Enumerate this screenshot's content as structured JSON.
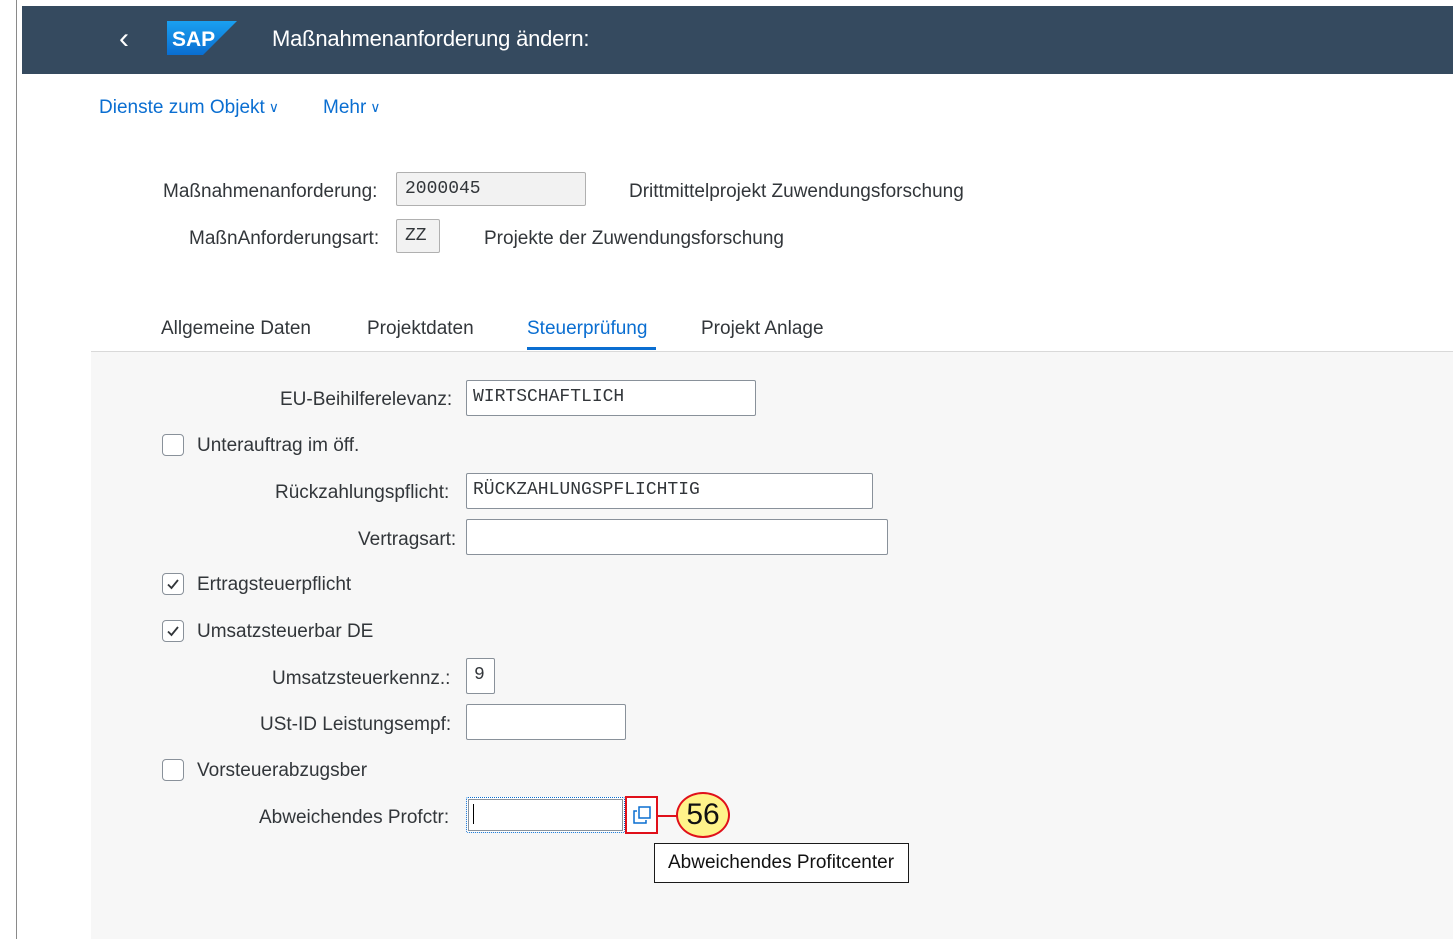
{
  "header": {
    "title": "Maßnahmenanforderung ändern:",
    "logo_text": "SAP",
    "colors": {
      "shell": "#354a5f",
      "accent": "#0a6ed1"
    }
  },
  "menu": {
    "services": "Dienste zum Objekt",
    "more": "Mehr"
  },
  "object": {
    "request_label": "Maßnahmenanforderung:",
    "request_value": "2000045",
    "request_desc": "Drittmittelprojekt Zuwendungsforschung",
    "type_label": "MaßnAnforderungsart:",
    "type_value": "ZZ",
    "type_desc": "Projekte der Zuwendungsforschung"
  },
  "tabs": [
    {
      "label": "Allgemeine Daten",
      "active": false
    },
    {
      "label": "Projektdaten",
      "active": false
    },
    {
      "label": "Steuerprüfung",
      "active": true
    },
    {
      "label": "Projekt Anlage",
      "active": false
    }
  ],
  "form": {
    "eu_label": "EU-Beihilferelevanz:",
    "eu_value": "WIRTSCHAFTLICH",
    "subcontract_label": "Unterauftrag im öff.",
    "subcontract_checked": false,
    "repay_label": "Rückzahlungspflicht:",
    "repay_value": "RÜCKZAHLUNGSPFLICHTIG",
    "contract_label": "Vertragsart:",
    "contract_value": "",
    "income_tax_label": "Ertragsteuerpflicht",
    "income_tax_checked": true,
    "vat_label": "Umsatzsteuerbar DE",
    "vat_checked": true,
    "vat_code_label": "Umsatzsteuerkennz.:",
    "vat_code_value": "9",
    "vat_id_label": "USt-ID Leistungsempf:",
    "vat_id_value": "",
    "input_tax_label": "Vorsteuerabzugsber",
    "input_tax_checked": false,
    "profit_center_label": "Abweichendes Profctr:",
    "profit_center_value": ""
  },
  "help": {
    "tooltip": "Abweichendes Profitcenter",
    "icon": "value-help-icon"
  },
  "annotation": {
    "step": "56"
  }
}
